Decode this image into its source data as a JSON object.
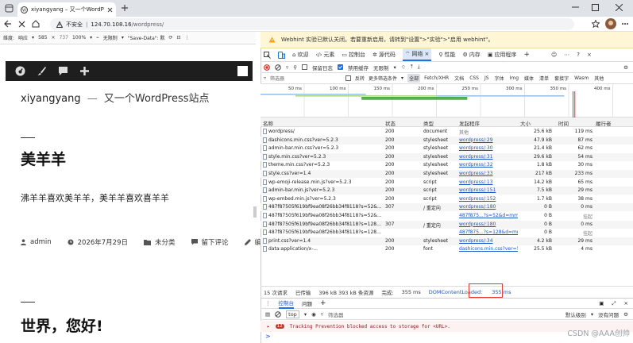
{
  "browser": {
    "tab_title": "xiyangyang – 又一个WordPress站点",
    "security_label": "不安全",
    "url_host": "124.70.108.16",
    "url_path": "/wordpress/"
  },
  "emulation": {
    "dim_label": "维度:",
    "device": "响应",
    "width": "585",
    "height": "737",
    "zoom": "100%",
    "throttle": "无限制",
    "save_data": "\"Save-Data\": 默"
  },
  "wp": {
    "site_title": "xiyangyang",
    "separator": "—",
    "tagline": "又一个WordPress站点",
    "post1_title": "美羊羊",
    "post1_excerpt": "沸羊羊喜欢美羊羊，美羊羊喜欢喜羊羊",
    "author": "admin",
    "date": "2026年7月29日",
    "category": "未分类",
    "comment": "留下评论",
    "edit": "编辑",
    "post2_title": "世界，您好!"
  },
  "devtools": {
    "warning": "Webhint 实验已默认关闭。若要重新启用，请转到\"设置\">\"实验\">\"启用 webhint\"。",
    "tabs": [
      {
        "label": "欢迎"
      },
      {
        "label": "元素"
      },
      {
        "label": "控制台"
      },
      {
        "label": "源代码"
      },
      {
        "label": "网络"
      },
      {
        "label": "性能"
      },
      {
        "label": "内存"
      },
      {
        "label": "应用程序"
      }
    ],
    "toolbar": {
      "preserve_log": "保留日志",
      "disable_cache": "禁用缓存",
      "throttle": "无限制"
    },
    "filter": {
      "placeholder": "筛选器",
      "invert": "反转",
      "hide_ext": "隐藏扩展 URL",
      "more_filters": "更多筛选条件",
      "chips": [
        "全部",
        "Fetch/XHR",
        "文档",
        "CSS",
        "JS",
        "字体",
        "Img",
        "媒体",
        "清单",
        "套接字",
        "Wasm",
        "其他"
      ]
    },
    "timeline_ticks": [
      "50 ms",
      "100 ms",
      "150 ms",
      "200 ms",
      "250 ms",
      "300 ms",
      "350 ms",
      "400 ms"
    ],
    "columns": [
      "名称",
      "状态",
      "类型",
      "发起程序",
      "大小",
      "时间",
      "履行者"
    ],
    "rows": [
      {
        "name": "wordpress/",
        "status": "200",
        "type": "document",
        "initiator": "其他",
        "size": "25.6 kB",
        "time": "119 ms"
      },
      {
        "name": "dashicons.min.css?ver=5.2.3",
        "status": "200",
        "type": "stylesheet",
        "initiator": "wordpress/:29",
        "size": "47.9 kB",
        "time": "87 ms"
      },
      {
        "name": "admin-bar.min.css?ver=5.2.3",
        "status": "200",
        "type": "stylesheet",
        "initiator": "wordpress/:30",
        "size": "21.4 kB",
        "time": "62 ms"
      },
      {
        "name": "style.min.css?ver=5.2.3",
        "status": "200",
        "type": "stylesheet",
        "initiator": "wordpress/:31",
        "size": "29.6 kB",
        "time": "54 ms"
      },
      {
        "name": "theme.min.css?ver=5.2.3",
        "status": "200",
        "type": "stylesheet",
        "initiator": "wordpress/:32",
        "size": "1.8 kB",
        "time": "30 ms"
      },
      {
        "name": "style.css?ver=1.4",
        "status": "200",
        "type": "stylesheet",
        "initiator": "wordpress/:33",
        "size": "217 kB",
        "time": "233 ms"
      },
      {
        "name": "wp-emoji-release.min.js?ver=5.2.3",
        "status": "200",
        "type": "script",
        "initiator": "wordpress/:13",
        "size": "14.2 kB",
        "time": "65 ms"
      },
      {
        "name": "admin-bar.min.js?ver=5.2.3",
        "status": "200",
        "type": "script",
        "initiator": "wordpress/:151",
        "size": "7.5 kB",
        "time": "29 ms"
      },
      {
        "name": "wp-embed.min.js?ver=5.2.3",
        "status": "200",
        "type": "script",
        "initiator": "wordpress/:152",
        "size": "1.7 kB",
        "time": "38 ms"
      },
      {
        "name": "487f87505f619bf9ea08f26bb34f8118?s=52&...",
        "status": "307",
        "type": "/ 重定向",
        "initiator": "wordpress/:180",
        "size": "0 B",
        "time": "0 ms"
      },
      {
        "name": "487f87505f619bf9ea08f26bb34f8118?s=52&...",
        "status": "",
        "type": "",
        "initiator": "487f875...?s=52&d=mm&",
        "size": "0 B",
        "time": "挂起"
      },
      {
        "name": "487f87505f619bf9ea08f26bb34f8118?s=128...",
        "status": "307",
        "type": "/ 重定向",
        "initiator": "wordpress/:180",
        "size": "0 B",
        "time": "0 ms"
      },
      {
        "name": "487f87505f619bf9ea08f26bb34f8118?s=128...",
        "status": "",
        "type": "",
        "initiator": "487f875...?s=128&d=mm",
        "size": "0 B",
        "time": "挂起"
      },
      {
        "name": "print.css?ver=1.4",
        "status": "200",
        "type": "stylesheet",
        "initiator": "wordpress/:34",
        "size": "4.2 kB",
        "time": "29 ms"
      },
      {
        "name": "data:application/x-...",
        "status": "200",
        "type": "font",
        "initiator": "dashicons.min.css?ver=5...",
        "size": "25.5 kB",
        "time": "4 ms"
      }
    ],
    "summary": {
      "requests": "15 次请求",
      "transferred": "已传输",
      "resources": "396 kB  393 kB 条资源",
      "finish_label": "完成:",
      "finish": "355 ms",
      "dcl_label": "DOMContentLoaded:",
      "dcl": "355 ms"
    },
    "drawer": {
      "tab_console": "控制台",
      "tab_issues": "问题"
    },
    "console": {
      "context": "top",
      "filter": "筛选器",
      "levels": "默认级别",
      "issues": "没有问题",
      "badge": "12",
      "message": "Tracking Prevention blocked access to storage for <URL>.",
      "prompt": ">"
    }
  },
  "watermark": "CSDN @AAA创帅"
}
